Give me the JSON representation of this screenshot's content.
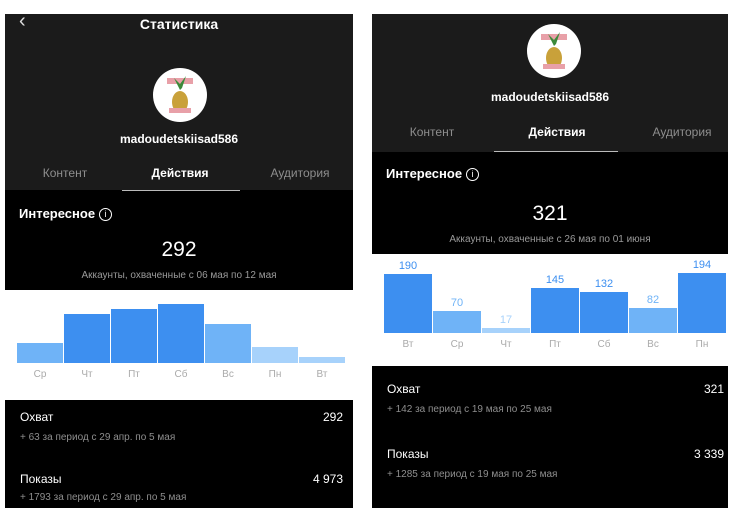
{
  "left": {
    "title": "Статистика",
    "back_icon": "chevron-left-icon",
    "username": "madoudetskiisad586",
    "tabs": [
      {
        "label": "Контент",
        "active": false
      },
      {
        "label": "Действия",
        "active": true
      },
      {
        "label": "Аудитория",
        "active": false
      }
    ],
    "section_title": "Интересное",
    "info_icon": "info-icon",
    "big_value": "292",
    "subtitle": "Аккаунты, охваченные с 06 мая по 12 мая",
    "chart_data": {
      "type": "bar",
      "categories": [
        "Ср",
        "Чт",
        "Пт",
        "Сб",
        "Вс",
        "Пн",
        "Вт"
      ],
      "values": [
        45,
        110,
        122,
        133,
        87,
        36,
        14
      ],
      "ylim": [
        0,
        140
      ],
      "colors": [
        "#6fb3f7",
        "#3d8ff0",
        "#3d8ff0",
        "#3d8ff0",
        "#6fb3f7",
        "#a7d2fb",
        "#a7d2fb"
      ]
    },
    "metrics": [
      {
        "label": "Охват",
        "value": "292",
        "sub": "+ 63 за период с 29 апр. по 5 мая"
      },
      {
        "label": "Показы",
        "value": "4 973",
        "sub": "+ 1793 за период с 29 апр. по 5 мая"
      }
    ]
  },
  "right": {
    "username": "madoudetskiisad586",
    "tabs": [
      {
        "label": "Контент",
        "active": false
      },
      {
        "label": "Действия",
        "active": true
      },
      {
        "label": "Аудитория",
        "active": false
      }
    ],
    "section_title": "Интересное",
    "info_icon": "info-icon",
    "big_value": "321",
    "subtitle": "Аккаунты, охваченные с 26 мая по 01 июня",
    "chart_data": {
      "type": "bar",
      "categories": [
        "Вт",
        "Ср",
        "Чт",
        "Пт",
        "Сб",
        "Вс",
        "Пн"
      ],
      "values": [
        190,
        70,
        17,
        145,
        132,
        82,
        194
      ],
      "labels": [
        "190",
        "70",
        "17",
        "145",
        "132",
        "82",
        "194"
      ],
      "ylim": [
        0,
        200
      ],
      "colors": [
        "#3d8ff0",
        "#6fb3f7",
        "#a7d2fb",
        "#3d8ff0",
        "#3d8ff0",
        "#6fb3f7",
        "#3d8ff0"
      ]
    },
    "metrics": [
      {
        "label": "Охват",
        "value": "321",
        "sub": "+ 142 за период с 19 мая по 25 мая"
      },
      {
        "label": "Показы",
        "value": "3 339",
        "sub": "+ 1285 за период с 19 мая по 25 мая"
      }
    ]
  }
}
